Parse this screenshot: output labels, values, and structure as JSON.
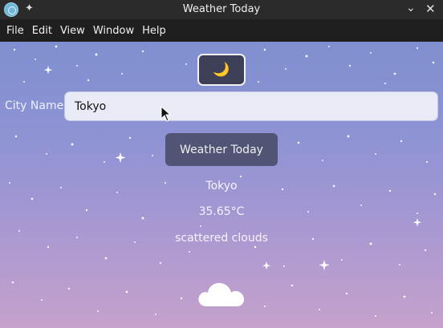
{
  "window": {
    "title": "Weather Today"
  },
  "menu": [
    "File",
    "Edit",
    "View",
    "Window",
    "Help"
  ],
  "theme_toggle": {
    "icon": "moon-icon",
    "glyph": "🌙",
    "accent": "#f1c232"
  },
  "form": {
    "label": "City Name:",
    "value": "Tokyo"
  },
  "button": {
    "label": "Weather Today"
  },
  "weather": {
    "city": "Tokyo",
    "temperature": "35.65°C",
    "description": "scattered clouds",
    "icon": "cloud-icon"
  },
  "colors": {
    "titlebar": "#2b2b2b",
    "menubar": "#1f1f1f",
    "button": "#515474",
    "toggle": "#3d3f58"
  }
}
